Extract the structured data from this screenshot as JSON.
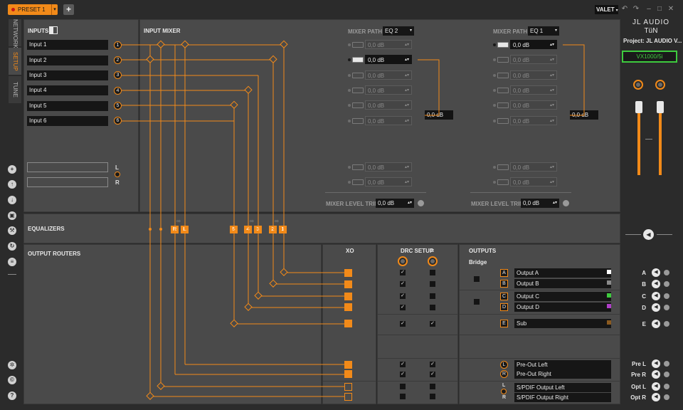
{
  "topbar": {
    "preset_label": "PRESET 1",
    "add_label": "+",
    "valet_label": "VALET",
    "icons": [
      "undo-icon",
      "redo-icon",
      "minimize-icon",
      "maximize-icon",
      "close-icon"
    ]
  },
  "sidebar": {
    "tabs": [
      {
        "label": "NETWORK",
        "active": false
      },
      {
        "label": "SETUP",
        "active": true
      },
      {
        "label": "TUNE",
        "active": false
      }
    ],
    "icons": [
      "add-icon",
      "upload-icon",
      "download-icon",
      "copy-icon",
      "wrench-icon",
      "refresh-icon",
      "list-icon"
    ],
    "bottom_icons": [
      "settings-icon",
      "copyright-icon",
      "help-icon"
    ]
  },
  "brand": {
    "logo_line1": "JL AUDIO",
    "logo_line2": "TüN",
    "project": "Project: JL AUDIO V...",
    "device": "VX1000/5i"
  },
  "inputs": {
    "title": "INPUTS",
    "items": [
      "Input 1",
      "Input 2",
      "Input 3",
      "Input 4",
      "Input 5",
      "Input 6"
    ],
    "numbers": [
      "1",
      "2",
      "3",
      "4",
      "5",
      "6"
    ],
    "empty_fields": [
      "",
      ""
    ],
    "lr": [
      "L",
      "R"
    ]
  },
  "input_mixer": {
    "title": "INPUT MIXER",
    "path_label": "MIXER PATH",
    "paths": [
      {
        "eq": "EQ 2",
        "sum": "0,0 dB",
        "trim_label": "MIXER LEVEL TRIM",
        "trim": "0,0 dB",
        "rows": [
          {
            "v": "0,0 dB",
            "active": false
          },
          {
            "v": "0,0 dB",
            "active": true
          },
          {
            "v": "0,0 dB",
            "active": false
          },
          {
            "v": "0,0 dB",
            "active": false
          },
          {
            "v": "0,0 dB",
            "active": false
          },
          {
            "v": "0,0 dB",
            "active": false
          },
          {
            "v": "0,0 dB",
            "active": false
          },
          {
            "v": "0,0 dB",
            "active": false
          }
        ]
      },
      {
        "eq": "EQ 1",
        "sum": "0,0 dB",
        "trim_label": "MIXER LEVEL TRIM",
        "trim": "0,0 dB",
        "rows": [
          {
            "v": "0,0 dB",
            "active": true
          },
          {
            "v": "0,0 dB",
            "active": false
          },
          {
            "v": "0,0 dB",
            "active": false
          },
          {
            "v": "0,0 dB",
            "active": false
          },
          {
            "v": "0,0 dB",
            "active": false
          },
          {
            "v": "0,0 dB",
            "active": false
          },
          {
            "v": "0,0 dB",
            "active": false
          },
          {
            "v": "0,0 dB",
            "active": false
          }
        ]
      }
    ]
  },
  "equalizers": {
    "title": "EQUALIZERS",
    "blocks": [
      "R",
      "L",
      "5",
      "4",
      "3",
      "2",
      "1"
    ],
    "links": [
      "∞",
      "∞",
      "∞"
    ]
  },
  "output_routers": {
    "title": "OUTPUT ROUTERS"
  },
  "xo": {
    "title": "XO"
  },
  "drc": {
    "title": "DRC SETUP",
    "menu_icon": "≡"
  },
  "outputs": {
    "title": "OUTPUTS",
    "bridge_label": "Bridge",
    "items": [
      {
        "letter": "A",
        "name": "Output A",
        "color": "#ffffff"
      },
      {
        "letter": "B",
        "name": "Output B",
        "color": "#8a8a8a"
      },
      {
        "letter": "C",
        "name": "Output C",
        "color": "#3ecb3e"
      },
      {
        "letter": "D",
        "name": "Output D",
        "color": "#b03ec8"
      },
      {
        "letter": "E",
        "name": "Sub",
        "color": "#8a5a20"
      },
      {
        "letter": "L",
        "name": "Pre-Out Left",
        "color": ""
      },
      {
        "letter": "R",
        "name": "Pre-Out Right",
        "color": ""
      },
      {
        "letter": "L",
        "name": "S/PDIF Output Left",
        "color": ""
      },
      {
        "letter": "R",
        "name": "S/PDIF Output Right",
        "color": ""
      }
    ]
  },
  "right_panel": {
    "routes": [
      "A",
      "B",
      "C",
      "D",
      "E",
      "Pre L",
      "Pre R",
      "Opt L",
      "Opt R"
    ],
    "master_level": 0.5
  }
}
